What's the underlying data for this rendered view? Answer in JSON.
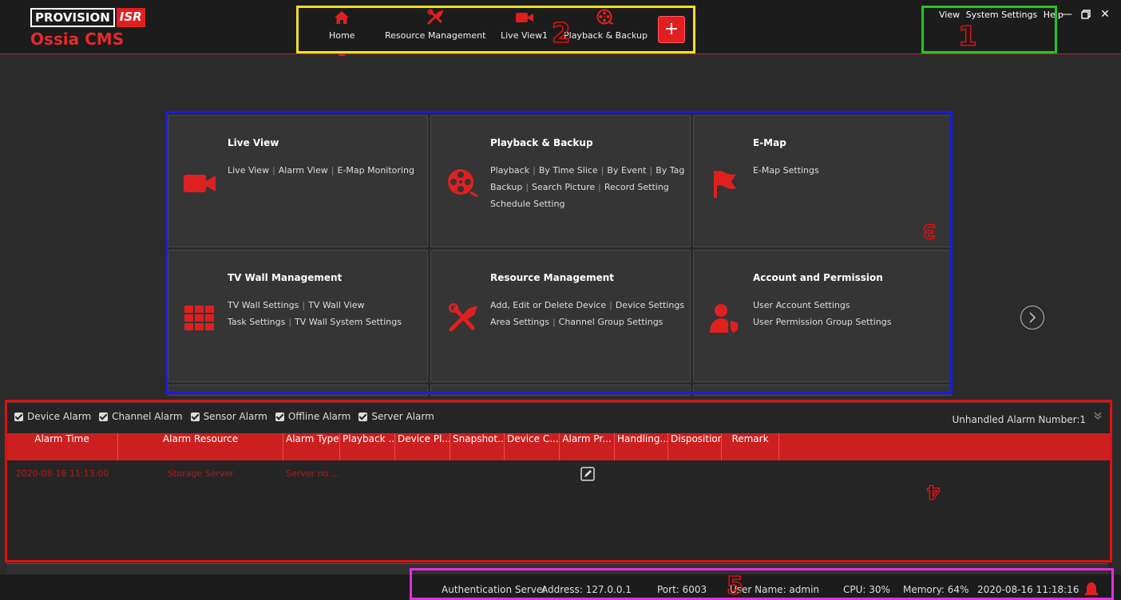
{
  "brand": {
    "logo_part1": "PROVISION",
    "logo_part2": "ISR",
    "product": "Ossia CMS"
  },
  "nav": {
    "items": [
      {
        "label": "Home",
        "icon": "home-icon",
        "active": true
      },
      {
        "label": "Resource Management",
        "icon": "tools-icon"
      },
      {
        "label": "Live View1",
        "icon": "camera-icon"
      },
      {
        "label": "Playback & Backup",
        "icon": "film-reel-icon"
      }
    ],
    "add_icon": "plus-icon"
  },
  "top_right": {
    "view": "View",
    "system_settings": "System Settings",
    "help": "Help"
  },
  "modules": [
    {
      "title": "Live View",
      "icon": "camera-icon",
      "lines": [
        [
          "Live View",
          "Alarm View",
          "E-Map Monitoring"
        ]
      ]
    },
    {
      "title": "Playback & Backup",
      "icon": "film-reel-icon",
      "lines": [
        [
          "Playback",
          "By Time Slice",
          "By Event",
          "By Tag"
        ],
        [
          "Backup",
          "Search Picture",
          "Record Setting"
        ],
        [
          "Schedule Setting"
        ]
      ]
    },
    {
      "title": "E-Map",
      "icon": "flag-icon",
      "lines": [
        [
          "E-Map Settings"
        ]
      ]
    },
    {
      "title": "TV Wall Management",
      "icon": "tv-wall-icon",
      "lines": [
        [
          "TV Wall Settings",
          "TV Wall View"
        ],
        [
          "Task Settings",
          "TV Wall System Settings"
        ]
      ]
    },
    {
      "title": "Resource Management",
      "icon": "tools-icon",
      "lines": [
        [
          "Add, Edit or Delete Device",
          "Device Settings"
        ],
        [
          "Area Settings",
          "Channel Group Settings"
        ]
      ]
    },
    {
      "title": "Account and Permission",
      "icon": "user-shield-icon",
      "lines": [
        [
          "User Account Settings"
        ],
        [
          "User Permission Group Settings"
        ]
      ]
    }
  ],
  "alarm": {
    "filters": [
      "Device Alarm",
      "Channel Alarm",
      "Sensor Alarm",
      "Offline Alarm",
      "Server Alarm"
    ],
    "unhandled": "Unhandled Alarm Number:1",
    "columns": [
      "Alarm Time",
      "Alarm Resource",
      "Alarm Type",
      "Playback ...",
      "Device Pl...",
      "Snapshot...",
      "Device C...",
      "Alarm Pr...",
      "Handling...",
      "Disposition",
      "Remark"
    ],
    "rows": [
      {
        "time": "2020-08-16 11:13:00",
        "resource": "Storage Server",
        "type": "Server no ..."
      }
    ]
  },
  "status": {
    "auth_server": "Authentication Server",
    "address": "Address: 127.0.0.1",
    "port": "Port: 6003",
    "user": "User Name: admin",
    "cpu": "CPU: 30%",
    "memory": "Memory: 64%",
    "datetime": "2020-08-16 11:18:16"
  },
  "annotations": [
    {
      "number": "1",
      "color": "#1fc81f"
    },
    {
      "number": "2",
      "color": "#f0e020"
    },
    {
      "number": "3",
      "color": "#1a1ae6"
    },
    {
      "number": "4",
      "color": "#e01010"
    },
    {
      "number": "5",
      "color": "#e030e0"
    }
  ],
  "colors": {
    "accent": "#e02020",
    "background": "#2b2b2b",
    "tile": "#353535",
    "header_red": "#cc2020"
  }
}
